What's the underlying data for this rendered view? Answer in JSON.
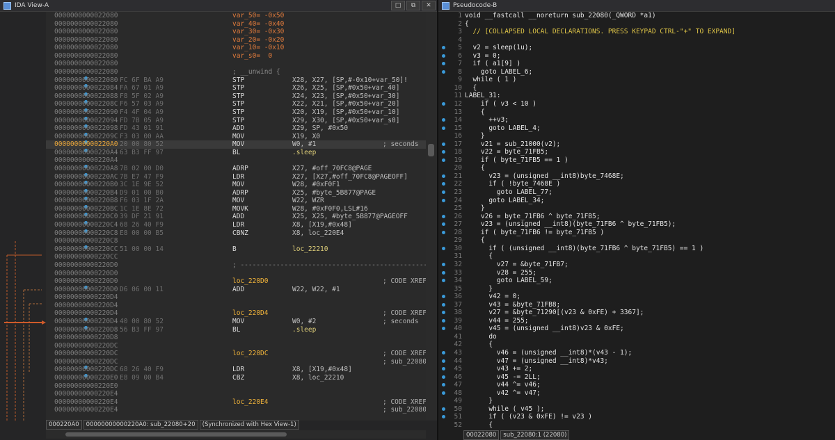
{
  "left": {
    "title": "IDA View-A",
    "asm": [
      {
        "addr": "0000000000022080",
        "bytes": "",
        "col1": "var_50= -0x50",
        "ops": "",
        "cmt": "",
        "k": "var"
      },
      {
        "addr": "0000000000022080",
        "bytes": "",
        "col1": "var_40= -0x40",
        "ops": "",
        "cmt": "",
        "k": "var"
      },
      {
        "addr": "0000000000022080",
        "bytes": "",
        "col1": "var_30= -0x30",
        "ops": "",
        "cmt": "",
        "k": "var"
      },
      {
        "addr": "0000000000022080",
        "bytes": "",
        "col1": "var_20= -0x20",
        "ops": "",
        "cmt": "",
        "k": "var"
      },
      {
        "addr": "0000000000022080",
        "bytes": "",
        "col1": "var_10= -0x10",
        "ops": "",
        "cmt": "",
        "k": "var"
      },
      {
        "addr": "0000000000022080",
        "bytes": "",
        "col1": "var_s0=  0",
        "ops": "",
        "cmt": "",
        "k": "var"
      },
      {
        "addr": "0000000000022080",
        "bytes": "",
        "col1": "",
        "ops": "",
        "cmt": "",
        "k": ""
      },
      {
        "addr": "0000000000022080",
        "bytes": "",
        "col1": "; __unwind {",
        "ops": "",
        "cmt": "",
        "k": "cmt"
      },
      {
        "addr": "0000000000022080",
        "bytes": "FC 6F BA A9",
        "col1": "STP",
        "ops": "X28, X27, [SP,#-0x10+var_50]!",
        "cmt": "",
        "k": ""
      },
      {
        "addr": "0000000000022084",
        "bytes": "FA 67 01 A9",
        "col1": "STP",
        "ops": "X26, X25, [SP,#0x50+var_40]",
        "cmt": "",
        "k": ""
      },
      {
        "addr": "0000000000022088",
        "bytes": "F8 5F 02 A9",
        "col1": "STP",
        "ops": "X24, X23, [SP,#0x50+var_30]",
        "cmt": "",
        "k": ""
      },
      {
        "addr": "000000000002208C",
        "bytes": "F6 57 03 A9",
        "col1": "STP",
        "ops": "X22, X21, [SP,#0x50+var_20]",
        "cmt": "",
        "k": ""
      },
      {
        "addr": "0000000000022090",
        "bytes": "F4 4F 04 A9",
        "col1": "STP",
        "ops": "X20, X19, [SP,#0x50+var_10]",
        "cmt": "",
        "k": ""
      },
      {
        "addr": "0000000000022094",
        "bytes": "FD 7B 05 A9",
        "col1": "STP",
        "ops": "X29, X30, [SP,#0x50+var_s0]",
        "cmt": "",
        "k": ""
      },
      {
        "addr": "0000000000022098",
        "bytes": "FD 43 01 91",
        "col1": "ADD",
        "ops": "X29, SP, #0x50",
        "cmt": "",
        "k": ""
      },
      {
        "addr": "000000000002209C",
        "bytes": "F3 03 00 AA",
        "col1": "MOV",
        "ops": "X19, X0",
        "cmt": "",
        "k": ""
      },
      {
        "addr": "00000000000220A0",
        "bytes": "20 00 80 52",
        "col1": "MOV",
        "ops": "W0, #1",
        "cmt": "; seconds",
        "k": "cur"
      },
      {
        "addr": "00000000000220A4",
        "bytes": "63 B3 FF 97",
        "col1": "BL",
        "ops": ".sleep",
        "cmt": "",
        "k": "fn"
      },
      {
        "addr": "00000000000220A4",
        "bytes": "",
        "col1": "",
        "ops": "",
        "cmt": "",
        "k": ""
      },
      {
        "addr": "00000000000220A8",
        "bytes": "7B 02 00 D0",
        "col1": "ADRP",
        "ops": "X27, #off_70FC8@PAGE",
        "cmt": "",
        "k": ""
      },
      {
        "addr": "00000000000220AC",
        "bytes": "7B E7 47 F9",
        "col1": "LDR",
        "ops": "X27, [X27,#off_70FC8@PAGEOFF]",
        "cmt": "",
        "k": ""
      },
      {
        "addr": "00000000000220B0",
        "bytes": "3C 1E 9E 52",
        "col1": "MOV",
        "ops": "W28, #0xF0F1",
        "cmt": "",
        "k": ""
      },
      {
        "addr": "00000000000220B4",
        "bytes": "D9 01 00 B0",
        "col1": "ADRP",
        "ops": "X25, #byte_5B877@PAGE",
        "cmt": "",
        "k": ""
      },
      {
        "addr": "00000000000220B8",
        "bytes": "F6 03 1F 2A",
        "col1": "MOV",
        "ops": "W22, WZR",
        "cmt": "",
        "k": ""
      },
      {
        "addr": "00000000000220BC",
        "bytes": "1C 1E 8E 72",
        "col1": "MOVK",
        "ops": "W28, #0xF0F0,LSL#16",
        "cmt": "",
        "k": ""
      },
      {
        "addr": "00000000000220C0",
        "bytes": "39 DF 21 91",
        "col1": "ADD",
        "ops": "X25, X25, #byte_5B877@PAGEOFF",
        "cmt": "",
        "k": ""
      },
      {
        "addr": "00000000000220C4",
        "bytes": "68 26 40 F9",
        "col1": "LDR",
        "ops": "X8, [X19,#0x48]",
        "cmt": "",
        "k": ""
      },
      {
        "addr": "00000000000220C8",
        "bytes": "E8 00 00 B5",
        "col1": "CBNZ",
        "ops": "X8, loc_220E4",
        "cmt": "",
        "k": ""
      },
      {
        "addr": "00000000000220C8",
        "bytes": "",
        "col1": "",
        "ops": "",
        "cmt": "",
        "k": ""
      },
      {
        "addr": "00000000000220CC",
        "bytes": "51 00 00 14",
        "col1": "B",
        "ops": "loc_22210",
        "cmt": "",
        "k": ""
      },
      {
        "addr": "00000000000220CC",
        "bytes": "",
        "col1": "",
        "ops": "",
        "cmt": "",
        "k": ""
      },
      {
        "addr": "00000000000220D0",
        "bytes": "",
        "col1": "; ---------------------------------------------------------------",
        "ops": "",
        "cmt": "",
        "k": "cmt"
      },
      {
        "addr": "00000000000220D0",
        "bytes": "",
        "col1": "",
        "ops": "",
        "cmt": "",
        "k": ""
      },
      {
        "addr": "00000000000220D0",
        "bytes": "",
        "col1": "loc_220D0",
        "ops": "",
        "cmt": "; CODE XREF",
        "k": "lbl"
      },
      {
        "addr": "00000000000220D0",
        "bytes": "D6 06 00 11",
        "col1": "ADD",
        "ops": "W22, W22, #1",
        "cmt": "",
        "k": ""
      },
      {
        "addr": "00000000000220D4",
        "bytes": "",
        "col1": "",
        "ops": "",
        "cmt": "",
        "k": ""
      },
      {
        "addr": "00000000000220D4",
        "bytes": "",
        "col1": "",
        "ops": "",
        "cmt": "",
        "k": ""
      },
      {
        "addr": "00000000000220D4",
        "bytes": "",
        "col1": "loc_220D4",
        "ops": "",
        "cmt": "; CODE XREF",
        "k": "lbl"
      },
      {
        "addr": "00000000000220D4",
        "bytes": "40 00 80 52",
        "col1": "MOV",
        "ops": "W0, #2",
        "cmt": "; seconds",
        "k": ""
      },
      {
        "addr": "00000000000220D8",
        "bytes": "56 B3 FF 97",
        "col1": "BL",
        "ops": ".sleep",
        "cmt": "",
        "k": "fn"
      },
      {
        "addr": "00000000000220D8",
        "bytes": "",
        "col1": "",
        "ops": "",
        "cmt": "",
        "k": ""
      },
      {
        "addr": "00000000000220DC",
        "bytes": "",
        "col1": "",
        "ops": "",
        "cmt": "",
        "k": ""
      },
      {
        "addr": "00000000000220DC",
        "bytes": "",
        "col1": "loc_220DC",
        "ops": "",
        "cmt": "; CODE XREF",
        "k": "lbl"
      },
      {
        "addr": "00000000000220DC",
        "bytes": "",
        "col1": "",
        "ops": "",
        "cmt": "; sub_22080+",
        "k": ""
      },
      {
        "addr": "00000000000220DC",
        "bytes": "68 26 40 F9",
        "col1": "LDR",
        "ops": "X8, [X19,#0x48]",
        "cmt": "",
        "k": ""
      },
      {
        "addr": "00000000000220E0",
        "bytes": "E8 09 00 B4",
        "col1": "CBZ",
        "ops": "X8, loc_22210",
        "cmt": "",
        "k": ""
      },
      {
        "addr": "00000000000220E0",
        "bytes": "",
        "col1": "",
        "ops": "",
        "cmt": "",
        "k": ""
      },
      {
        "addr": "00000000000220E4",
        "bytes": "",
        "col1": "",
        "ops": "",
        "cmt": "",
        "k": ""
      },
      {
        "addr": "00000000000220E4",
        "bytes": "",
        "col1": "loc_220E4",
        "ops": "",
        "cmt": "; CODE XREF",
        "k": "lbl"
      },
      {
        "addr": "00000000000220E4",
        "bytes": "",
        "col1": "",
        "ops": "",
        "cmt": "; sub_22080+",
        "k": ""
      }
    ],
    "bp_rows": [
      8,
      9,
      10,
      11,
      12,
      13,
      14,
      15,
      16,
      17,
      19,
      20,
      21,
      22,
      23,
      24,
      25,
      26,
      27,
      29,
      34,
      38,
      39,
      44,
      45
    ],
    "status": [
      "000220A0",
      "00000000000220A0: sub_22080+20",
      "(Synchronized with Hex View-1)"
    ]
  },
  "right": {
    "title": "Pseudocode-B",
    "lines": [
      {
        "n": "1",
        "t": "void __fastcall __noreturn sub_22080(_QWORD *a1)",
        "k": "",
        "d": false
      },
      {
        "n": "2",
        "t": "{",
        "k": "",
        "d": false
      },
      {
        "n": "3",
        "t": "  // [COLLAPSED LOCAL DECLARATIONS. PRESS KEYPAD CTRL-\"+\" TO EXPAND]",
        "k": "cmt",
        "d": false
      },
      {
        "n": "4",
        "t": "",
        "k": "",
        "d": false
      },
      {
        "n": "5",
        "t": "  v2 = sleep(1u);",
        "k": "",
        "d": true
      },
      {
        "n": "6",
        "t": "  v3 = 0;",
        "k": "",
        "d": true
      },
      {
        "n": "7",
        "t": "  if ( a1[9] )",
        "k": "",
        "d": true
      },
      {
        "n": "8",
        "t": "    goto LABEL_6;",
        "k": "",
        "d": true
      },
      {
        "n": "9",
        "t": "  while ( 1 )",
        "k": "",
        "d": false
      },
      {
        "n": "10",
        "t": "  {",
        "k": "",
        "d": false
      },
      {
        "n": "11",
        "t": "LABEL_31:",
        "k": "",
        "d": false
      },
      {
        "n": "12",
        "t": "    if ( v3 < 10 )",
        "k": "",
        "d": true
      },
      {
        "n": "13",
        "t": "    {",
        "k": "",
        "d": false
      },
      {
        "n": "14",
        "t": "      ++v3;",
        "k": "",
        "d": true
      },
      {
        "n": "15",
        "t": "      goto LABEL_4;",
        "k": "",
        "d": true
      },
      {
        "n": "16",
        "t": "    }",
        "k": "",
        "d": false
      },
      {
        "n": "17",
        "t": "    v21 = sub_21000(v2);",
        "k": "",
        "d": true
      },
      {
        "n": "18",
        "t": "    v22 = byte_71FB5;",
        "k": "",
        "d": true
      },
      {
        "n": "19",
        "t": "    if ( byte_71FB5 == 1 )",
        "k": "",
        "d": true
      },
      {
        "n": "20",
        "t": "    {",
        "k": "",
        "d": false
      },
      {
        "n": "21",
        "t": "      v23 = (unsigned __int8)byte_7468E;",
        "k": "",
        "d": true
      },
      {
        "n": "22",
        "t": "      if ( !byte_7468E )",
        "k": "",
        "d": true
      },
      {
        "n": "23",
        "t": "        goto LABEL_77;",
        "k": "",
        "d": true
      },
      {
        "n": "24",
        "t": "      goto LABEL_34;",
        "k": "",
        "d": true
      },
      {
        "n": "25",
        "t": "    }",
        "k": "",
        "d": false
      },
      {
        "n": "26",
        "t": "    v26 = byte_71FB6 ^ byte_71FB5;",
        "k": "",
        "d": true
      },
      {
        "n": "27",
        "t": "    v23 = (unsigned __int8)(byte_71FB6 ^ byte_71FB5);",
        "k": "",
        "d": true
      },
      {
        "n": "28",
        "t": "    if ( byte_71FB6 != byte_71FB5 )",
        "k": "",
        "d": true
      },
      {
        "n": "29",
        "t": "    {",
        "k": "",
        "d": false
      },
      {
        "n": "30",
        "t": "      if ( (unsigned __int8)(byte_71FB6 ^ byte_71FB5) == 1 )",
        "k": "",
        "d": true
      },
      {
        "n": "31",
        "t": "      {",
        "k": "",
        "d": false
      },
      {
        "n": "32",
        "t": "        v27 = &byte_71FB7;",
        "k": "",
        "d": true
      },
      {
        "n": "33",
        "t": "        v28 = 255;",
        "k": "",
        "d": true
      },
      {
        "n": "34",
        "t": "        goto LABEL_59;",
        "k": "",
        "d": true
      },
      {
        "n": "35",
        "t": "      }",
        "k": "",
        "d": false
      },
      {
        "n": "36",
        "t": "      v42 = 0;",
        "k": "",
        "d": true
      },
      {
        "n": "37",
        "t": "      v43 = &byte_71FB8;",
        "k": "",
        "d": true
      },
      {
        "n": "38",
        "t": "      v27 = &byte_71290[(v23 & 0xFE) + 3367];",
        "k": "",
        "d": true
      },
      {
        "n": "39",
        "t": "      v44 = 255;",
        "k": "",
        "d": true
      },
      {
        "n": "40",
        "t": "      v45 = (unsigned __int8)v23 & 0xFE;",
        "k": "",
        "d": true
      },
      {
        "n": "41",
        "t": "      do",
        "k": "",
        "d": false
      },
      {
        "n": "42",
        "t": "      {",
        "k": "",
        "d": false
      },
      {
        "n": "43",
        "t": "        v46 = (unsigned __int8)*(v43 - 1);",
        "k": "",
        "d": true
      },
      {
        "n": "44",
        "t": "        v47 = (unsigned __int8)*v43;",
        "k": "",
        "d": true
      },
      {
        "n": "45",
        "t": "        v43 += 2;",
        "k": "",
        "d": true
      },
      {
        "n": "46",
        "t": "        v45 -= 2LL;",
        "k": "",
        "d": true
      },
      {
        "n": "47",
        "t": "        v44 ^= v46;",
        "k": "",
        "d": true
      },
      {
        "n": "48",
        "t": "        v42 ^= v47;",
        "k": "",
        "d": true
      },
      {
        "n": "49",
        "t": "      }",
        "k": "",
        "d": false
      },
      {
        "n": "50",
        "t": "      while ( v45 );",
        "k": "",
        "d": true
      },
      {
        "n": "51",
        "t": "      if ( (v23 & 0xFE) != v23 )",
        "k": "",
        "d": true
      },
      {
        "n": "52",
        "t": "      {",
        "k": "",
        "d": false
      }
    ],
    "status": [
      "00022080",
      "sub_22080:1 (22080)"
    ]
  },
  "colors": {
    "accent": "#3a9ad9",
    "label": "#f0b33a",
    "comment": "#e0c648"
  }
}
